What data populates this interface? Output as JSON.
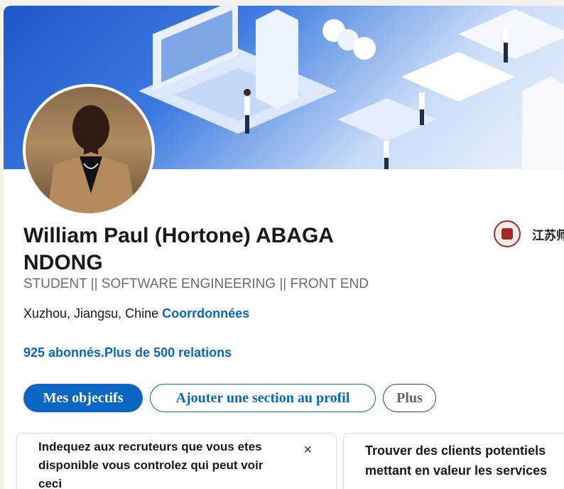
{
  "profile": {
    "name": "William Paul (Hortone) ABAGA NDONG",
    "headline": "STUDENT || SOFTWARE ENGINEERING || FRONT END",
    "location": "Xuzhou, Jiangsu, Chine",
    "contact_link": "Coorrdonnées",
    "stats": "925 abonnés.Plus de 500 relations"
  },
  "education": {
    "name": "江苏师"
  },
  "actions": {
    "primary": "Mes objectifs",
    "add_section": "Ajouter une section au profil",
    "more": "Plus"
  },
  "panels": {
    "open_to_work": "Indequez aux recruteurs que vous etes disponible vous controlez qui peut voir ceci",
    "close_icon": "×",
    "services": "Trouver des clients potentiels mettant en valeur les services"
  },
  "colors": {
    "link": "#0a66c2",
    "primary_button": "#0a66c2",
    "text": "#191919",
    "muted": "#6b6b6b"
  }
}
